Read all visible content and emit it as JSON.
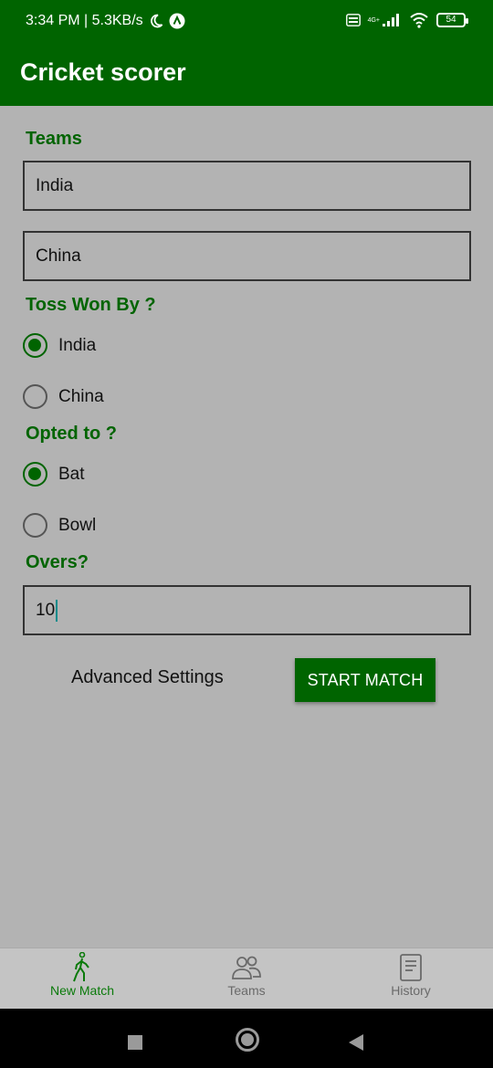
{
  "status": {
    "time_speed": "3:34 PM | 5.3KB/s",
    "network": "4G+",
    "battery": "54"
  },
  "app": {
    "title": "Cricket scorer"
  },
  "form": {
    "teams_label": "Teams",
    "team1": "India",
    "team2": "China",
    "toss_label": "Toss Won By ?",
    "toss_options": [
      {
        "label": "India",
        "checked": true
      },
      {
        "label": "China",
        "checked": false
      }
    ],
    "opted_label": "Opted to ?",
    "opted_options": [
      {
        "label": "Bat",
        "checked": true
      },
      {
        "label": "Bowl",
        "checked": false
      }
    ],
    "overs_label": "Overs?",
    "overs_value": "10",
    "advanced_label": "Advanced Settings",
    "start_label": "START MATCH"
  },
  "nav": {
    "items": [
      {
        "label": "New Match",
        "icon": "walking-person-icon",
        "active": true
      },
      {
        "label": "Teams",
        "icon": "people-icon",
        "active": false
      },
      {
        "label": "History",
        "icon": "document-icon",
        "active": false
      }
    ]
  },
  "colors": {
    "primary": "#006400",
    "background": "#b3b3b3"
  }
}
